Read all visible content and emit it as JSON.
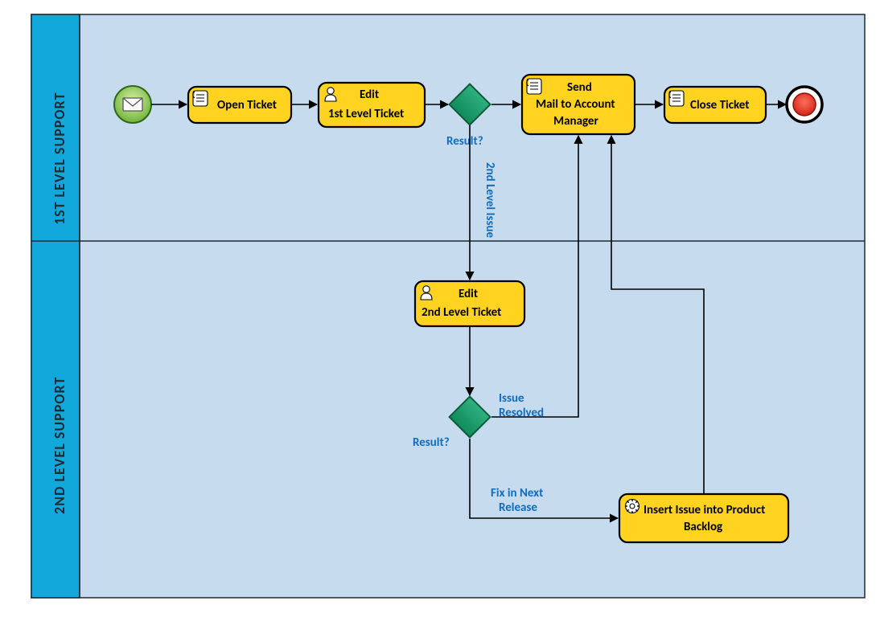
{
  "lanes": {
    "lane1": "1ST LEVEL SUPPORT",
    "lane2": "2ND LEVEL SUPPORT"
  },
  "tasks": {
    "open_ticket": "Open Ticket",
    "edit_l1_1": "Edit",
    "edit_l1_2": "1st Level Ticket",
    "send_mail_1": "Send",
    "send_mail_2": "Mail to Account",
    "send_mail_3": "Manager",
    "close_ticket": "Close Ticket",
    "edit_l2_1": "Edit",
    "edit_l2_2": "2nd Level Ticket",
    "backlog_1": "Insert Issue into Product",
    "backlog_2": "Backlog"
  },
  "annotations": {
    "result1": "Result?",
    "result2": "Result?",
    "second_level_issue": "2nd Level Issue",
    "issue_resolved_1": "Issue",
    "issue_resolved_2": "Resolved",
    "fix_next_1": "Fix in Next",
    "fix_next_2": "Release"
  },
  "icons": {
    "start": "start-message-icon",
    "end": "end-terminate-icon",
    "script": "script-icon",
    "user": "user-icon",
    "service": "service-icon"
  }
}
